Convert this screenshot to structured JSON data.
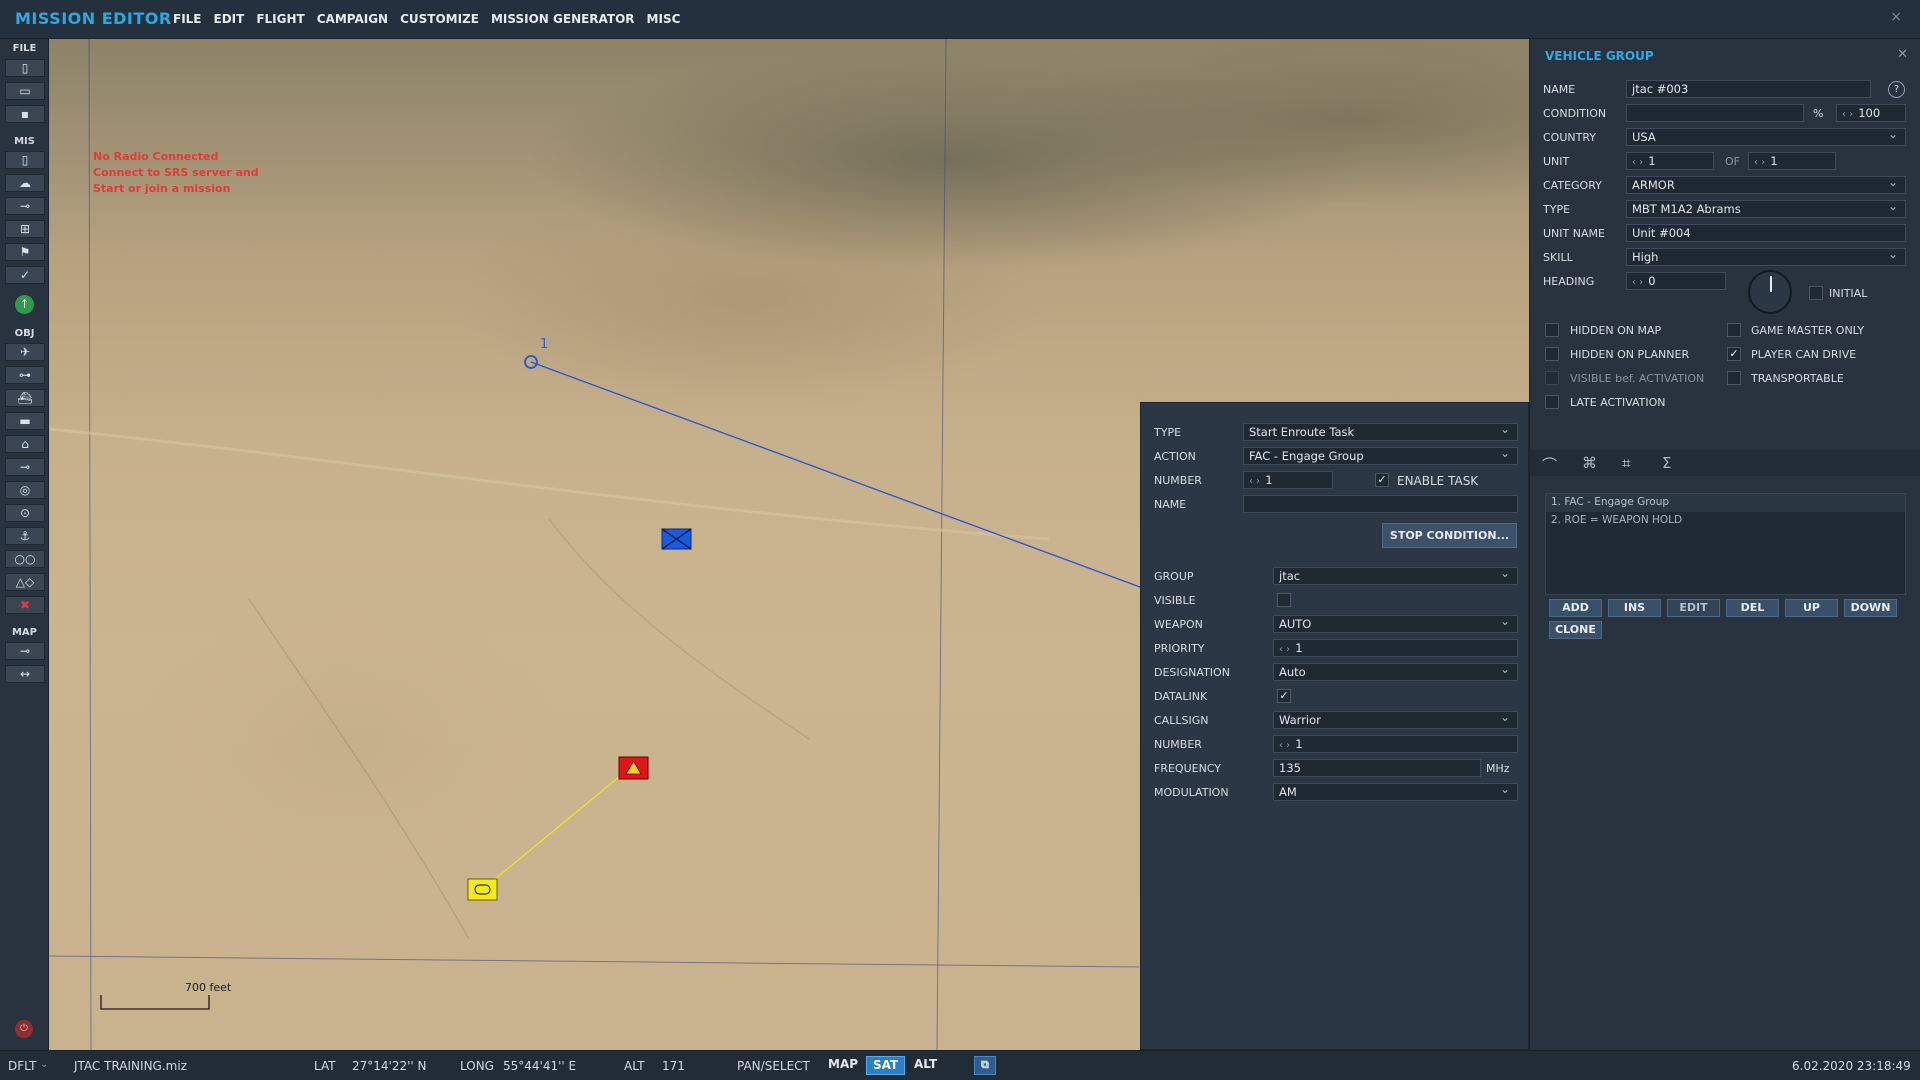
{
  "app": {
    "title": "MISSION EDITOR",
    "close_icon": "×"
  },
  "menu": [
    "FILE",
    "EDIT",
    "FLIGHT",
    "CAMPAIGN",
    "CUSTOMIZE",
    "MISSION GENERATOR",
    "MISC"
  ],
  "toolbar": {
    "sections": {
      "file": "FILE",
      "mis": "MIS",
      "obj": "OBJ",
      "map": "MAP"
    },
    "file_icons": [
      "new-icon",
      "open-icon",
      "save-icon"
    ],
    "mis_icons": [
      "briefing-icon",
      "weather-icon",
      "aircraft-route-icon",
      "targets-icon",
      "flag-icon",
      "check-icon",
      "radio-icon"
    ],
    "obj_icons": [
      "plane-icon",
      "helicopter-icon",
      "ship-icon",
      "vehicle-icon",
      "group-icon",
      "static-icon",
      "target-zone-icon",
      "trigger-zone-icon",
      "navy-icon",
      "templates-icon",
      "shapes-icon",
      "delete-icon"
    ],
    "map_icons": [
      "map-options-icon",
      "ruler-icon"
    ]
  },
  "map": {
    "radio_warning": [
      "No Radio Connected",
      "Connect to SRS server and",
      "Start or join a mission"
    ],
    "waypoint_label": "1",
    "scale_label": "700 feet"
  },
  "task": {
    "type_label": "TYPE",
    "type_value": "Start Enroute Task",
    "action_label": "ACTION",
    "action_value": "FAC - Engage Group",
    "number_label": "NUMBER",
    "number_value": "1",
    "enable_label": "ENABLE TASK",
    "enable_checked": "✓",
    "name_label": "NAME",
    "name_value": "",
    "stop_button": "STOP CONDITION...",
    "group_label": "GROUP",
    "group_value": "jtac",
    "visible_label": "VISIBLE",
    "weapon_label": "WEAPON",
    "weapon_value": "AUTO",
    "priority_label": "PRIORITY",
    "priority_value": "1",
    "designation_label": "DESIGNATION",
    "designation_value": "Auto",
    "datalink_label": "DATALINK",
    "datalink_checked": "✓",
    "callsign_label": "CALLSIGN",
    "callsign_value": "Warrior",
    "number2_label": "NUMBER",
    "number2_value": "1",
    "frequency_label": "FREQUENCY",
    "frequency_value": "135",
    "frequency_unit": "MHz",
    "modulation_label": "MODULATION",
    "modulation_value": "AM"
  },
  "vehicle_group": {
    "title": "VEHICLE GROUP",
    "name_label": "NAME",
    "name_value": "jtac #003",
    "help": "?",
    "condition_label": "CONDITION",
    "condition_unit": "%",
    "condition_value": "100",
    "country_label": "COUNTRY",
    "country_value": "USA",
    "unit_label": "UNIT",
    "unit_value": "1",
    "unit_of": "OF",
    "unit_total": "1",
    "category_label": "CATEGORY",
    "category_value": "ARMOR",
    "type_label": "TYPE",
    "type_value": "MBT M1A2 Abrams",
    "unit_name_label": "UNIT NAME",
    "unit_name_value": "Unit #004",
    "skill_label": "SKILL",
    "skill_value": "High",
    "heading_label": "HEADING",
    "heading_value": "0",
    "initial_label": "INITIAL",
    "hidden_map_label": "HIDDEN ON MAP",
    "gm_only_label": "GAME MASTER ONLY",
    "hidden_planner_label": "HIDDEN ON PLANNER",
    "player_drive_label": "PLAYER CAN DRIVE",
    "player_drive_checked": "✓",
    "visible_act_label": "VISIBLE bef. ACTIVATION",
    "transportable_label": "TRANSPORTABLE",
    "late_act_label": "LATE ACTIVATION",
    "tabs": [
      "route-icon",
      "triggered-actions-icon",
      "advanced-waypoint-actions-icon",
      "summary-icon"
    ],
    "tasks": [
      "1. FAC - Engage Group",
      "2. ROE = WEAPON HOLD"
    ],
    "buttons": {
      "add": "ADD",
      "ins": "INS",
      "edit": "EDIT",
      "del": "DEL",
      "up": "UP",
      "down": "DOWN",
      "clone": "CLONE"
    }
  },
  "status": {
    "profile": "DFLT",
    "file": "JTAC TRAINING.miz",
    "lat_label": "LAT",
    "lat_value": "27°14'22'' N",
    "long_label": "LONG",
    "long_value": "55°44'41'' E",
    "alt_label": "ALT",
    "alt_value": "171",
    "mode": "PAN/SELECT",
    "map_btn": "MAP",
    "sat_btn": "SAT",
    "alt_btn": "ALT",
    "datetime": "6.02.2020 23:18:49"
  },
  "colors": {
    "accent": "#2fa7df",
    "blue_unit": "#1a5be0",
    "red_unit": "#e01515",
    "yellow_unit": "#f5ea1a"
  }
}
